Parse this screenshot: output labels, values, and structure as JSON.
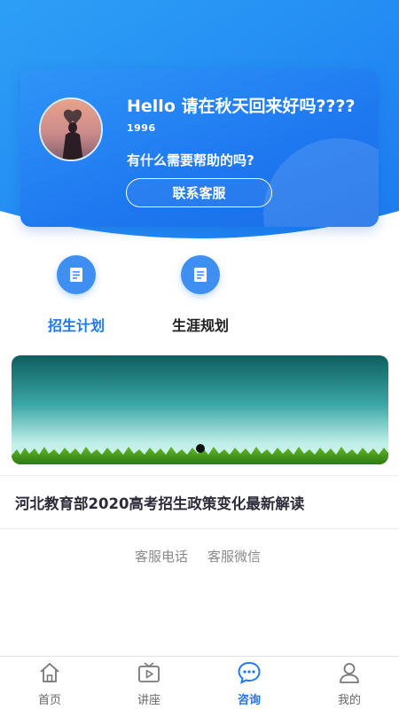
{
  "profile": {
    "greeting": "Hello 请在秋天回来好吗????",
    "subtitle": "1996",
    "question": "有什么需要帮助的吗?",
    "contact_button": "联系客服"
  },
  "menu": [
    {
      "label": "招生计划",
      "icon": "document-icon",
      "active": true
    },
    {
      "label": "生涯规划",
      "icon": "document-icon",
      "active": false
    }
  ],
  "banner": {
    "slide_count": 1,
    "current_slide": 1
  },
  "news": {
    "title": "河北教育部2020高考招生政策变化最新解读"
  },
  "service": {
    "phone": "客服电话",
    "wechat": "客服微信"
  },
  "tabbar": [
    {
      "label": "首页",
      "icon": "home-icon"
    },
    {
      "label": "讲座",
      "icon": "tv-play-icon"
    },
    {
      "label": "咨询",
      "icon": "chat-bubble-icon",
      "active": true
    },
    {
      "label": "我的",
      "icon": "user-icon"
    }
  ],
  "colors": {
    "primary": "#1e78f0",
    "header_gradient_top": "#2a9bf5",
    "header_gradient_bottom": "#1c7ef0"
  }
}
